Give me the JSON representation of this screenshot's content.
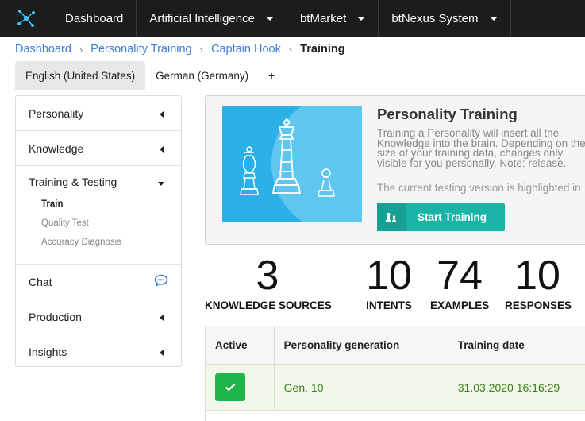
{
  "topnav": {
    "items": [
      {
        "label": "Dashboard",
        "has_dropdown": false
      },
      {
        "label": "Artificial Intelligence",
        "has_dropdown": true
      },
      {
        "label": "btMarket",
        "has_dropdown": true
      },
      {
        "label": "btNexus System",
        "has_dropdown": true
      }
    ]
  },
  "breadcrumb": {
    "items": [
      "Dashboard",
      "Personality Training",
      "Captain Hook"
    ],
    "current": "Training",
    "separator": "›"
  },
  "language_tabs": {
    "active": "English (United States)",
    "other": "German (Germany)",
    "add": "+"
  },
  "sidebar": {
    "personality": "Personality",
    "knowledge": "Knowledge",
    "training_testing": "Training & Testing",
    "sub_items": [
      "Train",
      "Quality Test",
      "Accuracy Diagnosis"
    ],
    "active_sub": "Train",
    "chat": "Chat",
    "production": "Production",
    "insights": "Insights"
  },
  "card": {
    "title": "Personality Training",
    "text": "Training a Personality will insert all the Knowledge into the brain. Depending on the size of your training data, changes only visible for you personally. Note: release.",
    "text2": "The current testing version is highlighted in",
    "button": "Start Training",
    "hero_color": "#2bb0e8",
    "button_color": "#1ab3a6"
  },
  "stats": [
    {
      "value": "3",
      "label": "KNOWLEDGE SOURCES"
    },
    {
      "value": "10",
      "label": "INTENTS"
    },
    {
      "value": "74",
      "label": "EXAMPLES"
    },
    {
      "value": "10",
      "label": "RESPONSES"
    }
  ],
  "table": {
    "headers": [
      "Active",
      "Personality generation",
      "Training date"
    ],
    "rows": [
      {
        "active": true,
        "generation": "Gen. 10",
        "date": "31.03.2020 16:16:29"
      }
    ],
    "active_color": "#1eb54a",
    "row_text_color": "#3a7f16"
  },
  "colors": {
    "nav_bg": "#1c1c1c",
    "link": "#3b7dd8"
  }
}
